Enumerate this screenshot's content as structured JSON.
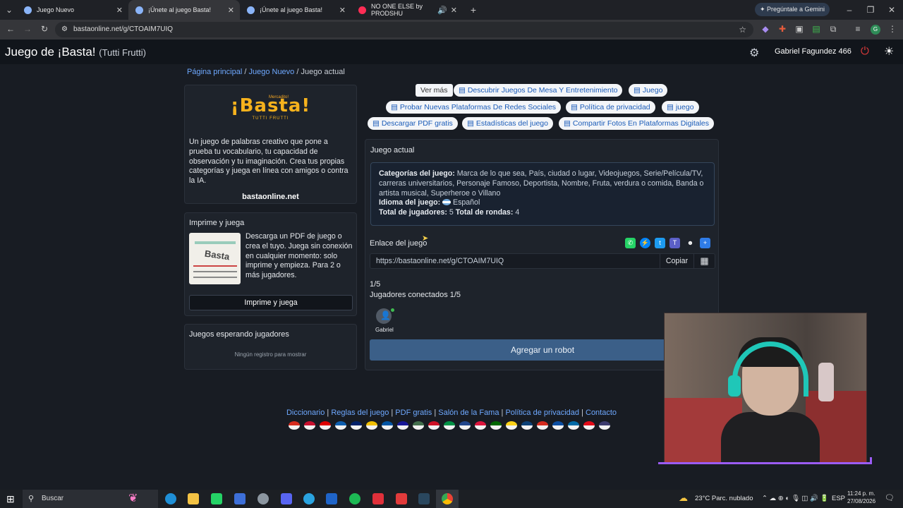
{
  "browser": {
    "tabs": [
      {
        "title": "Juego Nuevo"
      },
      {
        "title": "¡Únete al juego Basta!"
      },
      {
        "title": "¡Únete al juego Basta!"
      },
      {
        "title": "NO ONE ELSE by PRODSHU"
      }
    ],
    "gemini_label": "Pregúntale a Gemini",
    "url": "bastaonline.net/g/CTOAIM7UIQ",
    "profile_initial": "G"
  },
  "app": {
    "title": "Juego de ¡Basta!",
    "subtitle": "(Tutti Frutti)",
    "user_name": "Gabriel Fagundez 466"
  },
  "breadcrumb": {
    "home": "Página principal",
    "new_game": "Juego Nuevo",
    "current": "Juego actual"
  },
  "promo": {
    "logo_text": "¡Basta!",
    "logo_sub": "TUTTI FRUTTI",
    "logo_tag": "Mercadito!",
    "description": "Un juego de palabras creativo que pone a prueba tu vocabulario, tu capacidad de observación y tu imaginación. Crea tus propias categorías y juega en línea con amigos o contra la IA.",
    "site": "bastaonline.net"
  },
  "print_card": {
    "title": "Imprime y juega",
    "text": "Descarga un PDF de juego o crea el tuyo. Juega sin conexión en cualquier momento: solo imprime y empieza. Para 2 o más jugadores.",
    "button": "Imprime y juega"
  },
  "waiting_card": {
    "title": "Juegos esperando jugadores",
    "empty": "Ningún registro para mostrar"
  },
  "pills": {
    "more": "Ver más",
    "items": [
      "Descubrir Juegos De Mesa Y Entretenimiento",
      "Juego",
      "Probar Nuevas Plataformas De Redes Sociales",
      "Política de privacidad",
      "juego",
      "Descargar PDF gratis",
      "Estadísticas del juego",
      "Compartir Fotos En Plataformas Digitales"
    ]
  },
  "game": {
    "header": "Juego actual",
    "categories_label": "Categorías del juego:",
    "categories": "Marca de lo que sea, País, ciudad o lugar, Videojuegos, Serie/Película/TV, carreras universitarios, Personaje Famoso, Deportista, Nombre, Fruta, verdura o comida, Banda o artista musical, Superheroe o Villano",
    "language_label": "Idioma del juego:",
    "language": "Español",
    "players_label": "Total de jugadores:",
    "players": "5",
    "rounds_label": "Total de rondas:",
    "rounds": "4",
    "link_label": "Enlace del juego",
    "link": "https://bastaonline.net/g/CTOAIM7UIQ",
    "copy": "Copiar",
    "count": "1/5",
    "connected": "Jugadores conectados 1/5",
    "player_name": "Gabriel",
    "robot_button": "Agregar un robot"
  },
  "footer": {
    "links": [
      "Diccionario",
      "Reglas del juego",
      "PDF gratis",
      "Salón de la Fama",
      "Política de privacidad",
      "Contacto"
    ],
    "flag_colors": [
      "#d52b1e",
      "#c8102e",
      "#dd0000",
      "#0d5eaf",
      "#012169",
      "#f1bf00",
      "#0055a4",
      "#171796",
      "#436f4d",
      "#ce1126",
      "#009246",
      "#21468b",
      "#dc143c",
      "#006600",
      "#fcd116",
      "#0c4076",
      "#d52b1e",
      "#0b4ea2",
      "#006aa7",
      "#e30a17",
      "#3c3b6e"
    ]
  },
  "taskbar": {
    "search": "Buscar",
    "weather": "23°C  Parc. nublado",
    "lang": "ESP",
    "time": "11:24 p. m.",
    "date": "27/08/2026"
  }
}
